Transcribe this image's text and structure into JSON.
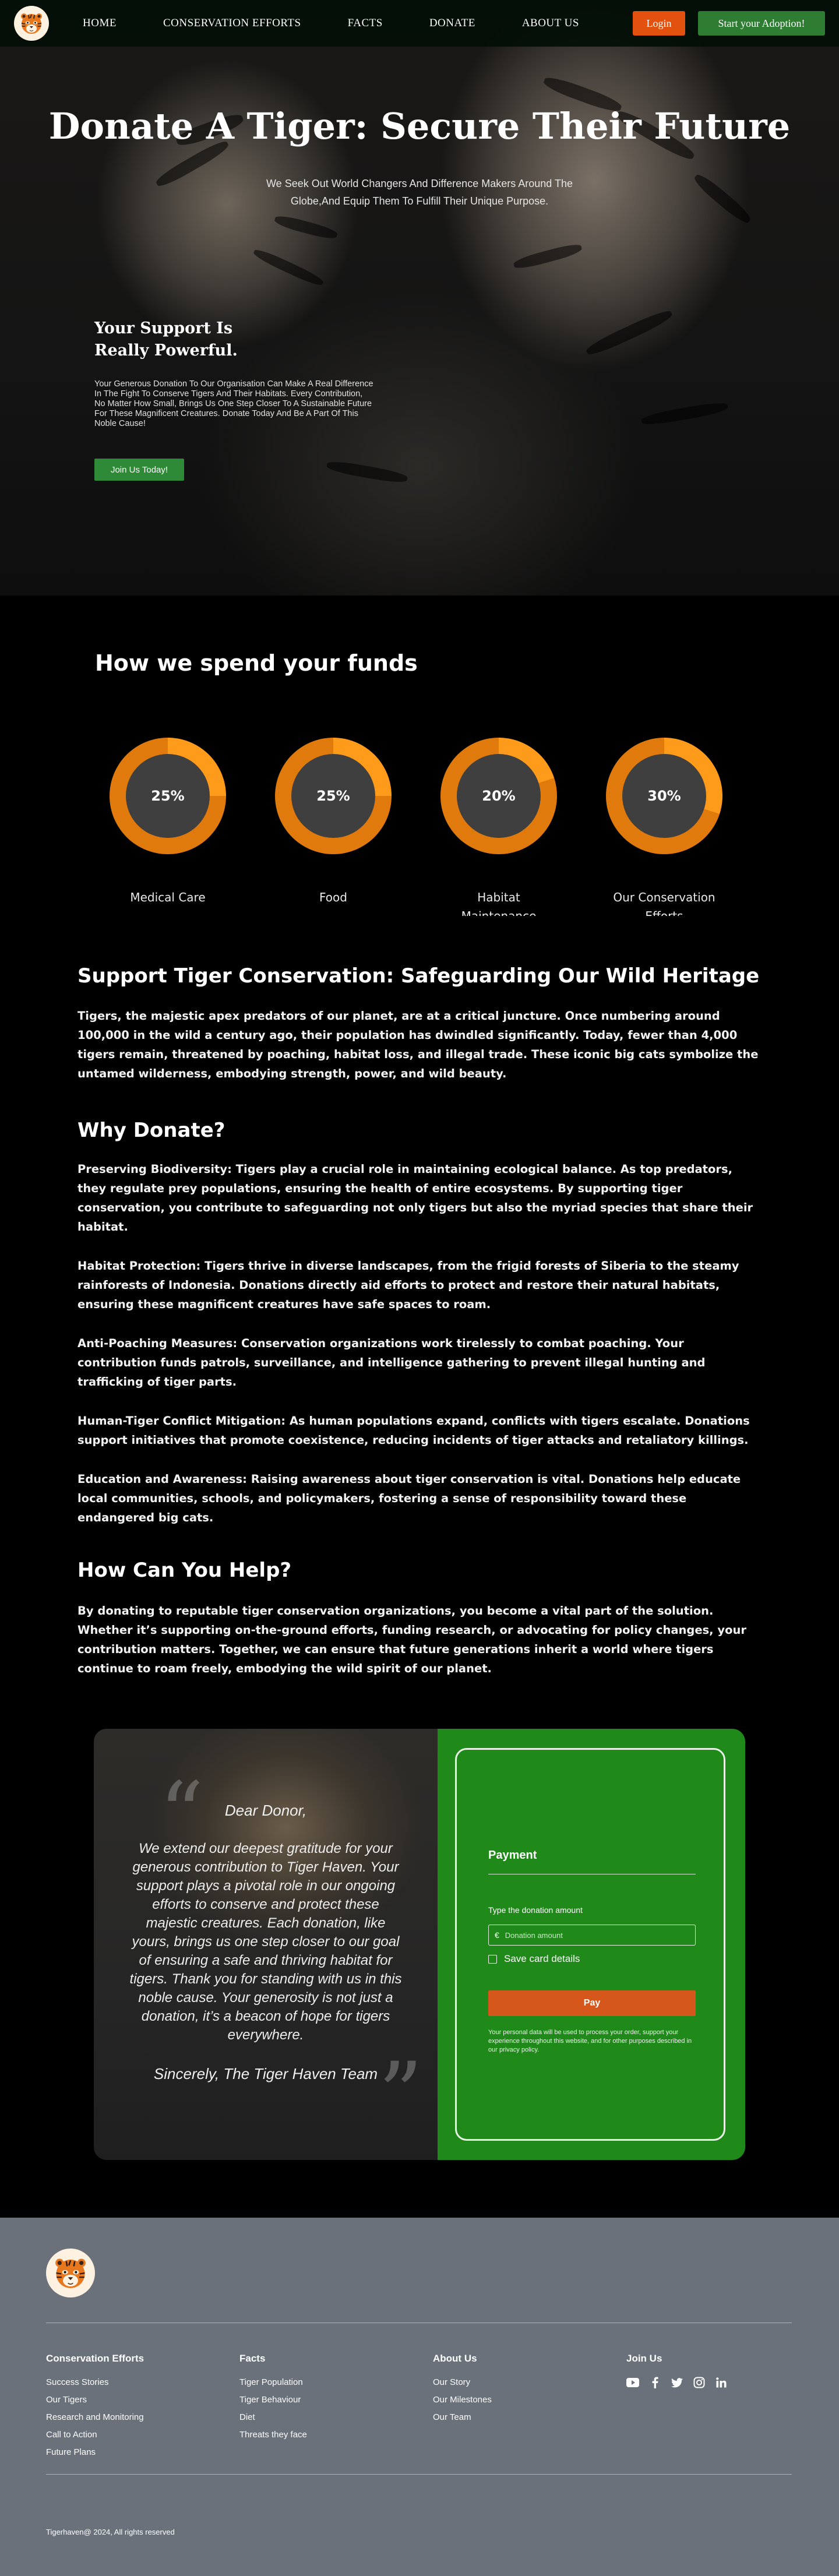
{
  "nav": {
    "links": [
      "HOME",
      "CONSERVATION EFFORTS",
      "FACTS",
      "DONATE",
      "ABOUT US"
    ],
    "login": "Login",
    "adopt": "Start your Adoption!"
  },
  "hero": {
    "title": "Donate A Tiger: Secure Their Future",
    "subtitle": "We Seek Out World Changers And Difference Makers Around The Globe,And Equip Them To Fulfill Their Unique Purpose.",
    "support_title": "Your Support Is Really Powerful.",
    "support_text": "Your Generous Donation To Our Organisation Can Make A Real Difference In The Fight To Conserve Tigers And Their Habitats. Every Contribution, No Matter How Small, Brings Us One Step Closer To A Sustainable Future For These Magnificent Creatures. Donate Today And Be A Part Of This Noble Cause!",
    "join_button": "Join Us Today!"
  },
  "funds": {
    "title": "How we spend your funds",
    "items": [
      {
        "percent": "25%",
        "value": 25,
        "label": "Medical Care"
      },
      {
        "percent": "25%",
        "value": 25,
        "label": "Food"
      },
      {
        "percent": "20%",
        "value": 20,
        "label": "Habitat Maintenance"
      },
      {
        "percent": "30%",
        "value": 30,
        "label": "Our Conservation Efforts"
      }
    ],
    "colors": {
      "track": "#e07a0c",
      "fill": "#ff9b1a",
      "inner": "#3f3f3f"
    }
  },
  "article": {
    "heading1": "Support Tiger Conservation: Safeguarding Our Wild Heritage",
    "intro": "Tigers, the majestic apex predators of our planet, are at a critical juncture. Once numbering around 100,000 in the wild a century ago, their population has dwindled significantly. Today, fewer than 4,000 tigers remain, threatened by poaching, habitat loss, and illegal trade. These iconic big cats symbolize the untamed wilderness, embodying strength, power, and wild beauty.",
    "heading2": "Why Donate?",
    "why": [
      "Preserving Biodiversity: Tigers play a crucial role in maintaining ecological balance. As top predators, they regulate prey populations, ensuring the health of entire ecosystems. By supporting tiger conservation, you contribute to safeguarding not only tigers but also the myriad species that share their habitat.",
      "Habitat Protection: Tigers thrive in diverse landscapes, from the frigid forests of Siberia to the steamy rainforests of Indonesia. Donations directly aid efforts to protect and restore their natural habitats, ensuring these magnificent creatures have safe spaces to roam.",
      "Anti-Poaching Measures: Conservation organizations work tirelessly to combat poaching. Your contribution funds patrols, surveillance, and intelligence gathering to prevent illegal hunting and trafficking of tiger parts.",
      "Human-Tiger Conflict Mitigation: As human populations expand, conflicts with tigers escalate. Donations support initiatives that promote coexistence, reducing incidents of tiger attacks and retaliatory killings.",
      "Education and Awareness: Raising awareness about tiger conservation is vital. Donations help educate local communities, schools, and policymakers, fostering a sense of responsibility toward these endangered big cats."
    ],
    "heading3": "How Can You Help?",
    "help": "By donating to reputable tiger conservation organizations, you become a vital part of the solution. Whether it’s supporting on-the-ground efforts, funding research, or advocating for policy changes, your contribution matters. Together, we can ensure that future generations inherit a world where tigers continue to roam freely, embodying the wild spirit of our planet."
  },
  "letter": {
    "greeting": "Dear Donor,",
    "body": "We extend our deepest gratitude for your generous contribution to Tiger Haven. Your support plays a pivotal role in our ongoing efforts to conserve and protect these majestic creatures. Each donation, like yours, brings us one step closer to our goal of ensuring a safe and thriving habitat for tigers. Thank you for standing with us in this noble cause. Your generosity is not just a donation, it’s a beacon of hope for tigers everywhere.",
    "signoff": "Sincerely, The Tiger Haven Team"
  },
  "payment": {
    "title": "Payment",
    "amount_label": "Type the donation amount",
    "currency": "€",
    "amount_placeholder": "Donation amount",
    "save_card": "Save card details",
    "pay_button": "Pay",
    "privacy": "Your personal data will be used to process your order, support your experience throughout this website, and for other purposes described in our privacy policy."
  },
  "footer": {
    "columns": [
      {
        "title": "Conservation Efforts",
        "links": [
          "Success Stories",
          "Our Tigers",
          "Research and Monitoring",
          "Call to Action",
          "Future Plans"
        ]
      },
      {
        "title": "Facts",
        "links": [
          "Tiger Population",
          "Tiger Behaviour",
          "Diet",
          "Threats they face"
        ]
      },
      {
        "title": "About Us",
        "links": [
          "Our Story",
          "Our Milestones",
          "Our Team"
        ]
      },
      {
        "title": "Join Us",
        "links": []
      }
    ],
    "socials": [
      "youtube-icon",
      "facebook-icon",
      "twitter-icon",
      "instagram-icon",
      "linkedin-icon"
    ],
    "copyright": "Tigerhaven@ 2024, All rights reserved"
  }
}
